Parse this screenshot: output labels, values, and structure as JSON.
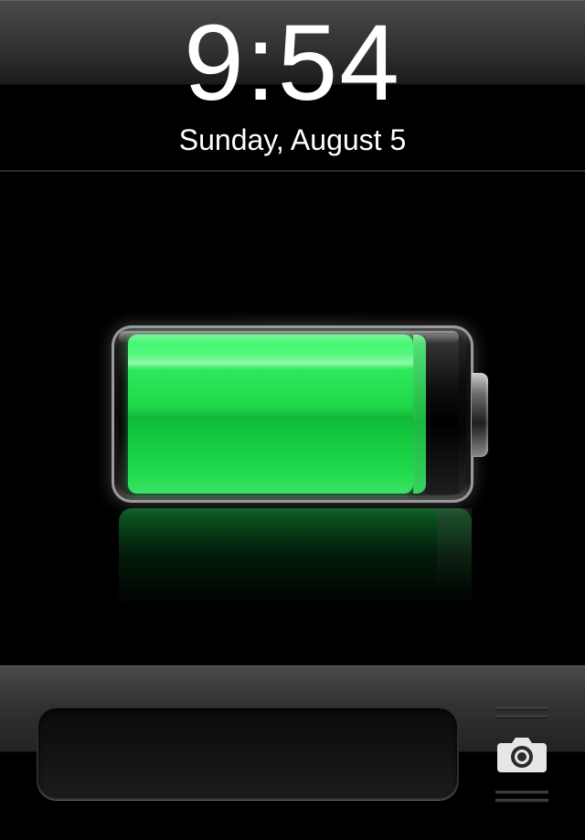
{
  "lock_screen": {
    "time": "9:54",
    "date": "Sunday, August 5"
  },
  "battery": {
    "charge_level": 0.9,
    "fill_color": "#1fd849",
    "state": "charging"
  },
  "slider": {
    "label": ""
  },
  "camera": {
    "icon": "camera-icon"
  },
  "colors": {
    "background": "#000000",
    "bar": "#333333",
    "battery_green": "#1fd849"
  }
}
